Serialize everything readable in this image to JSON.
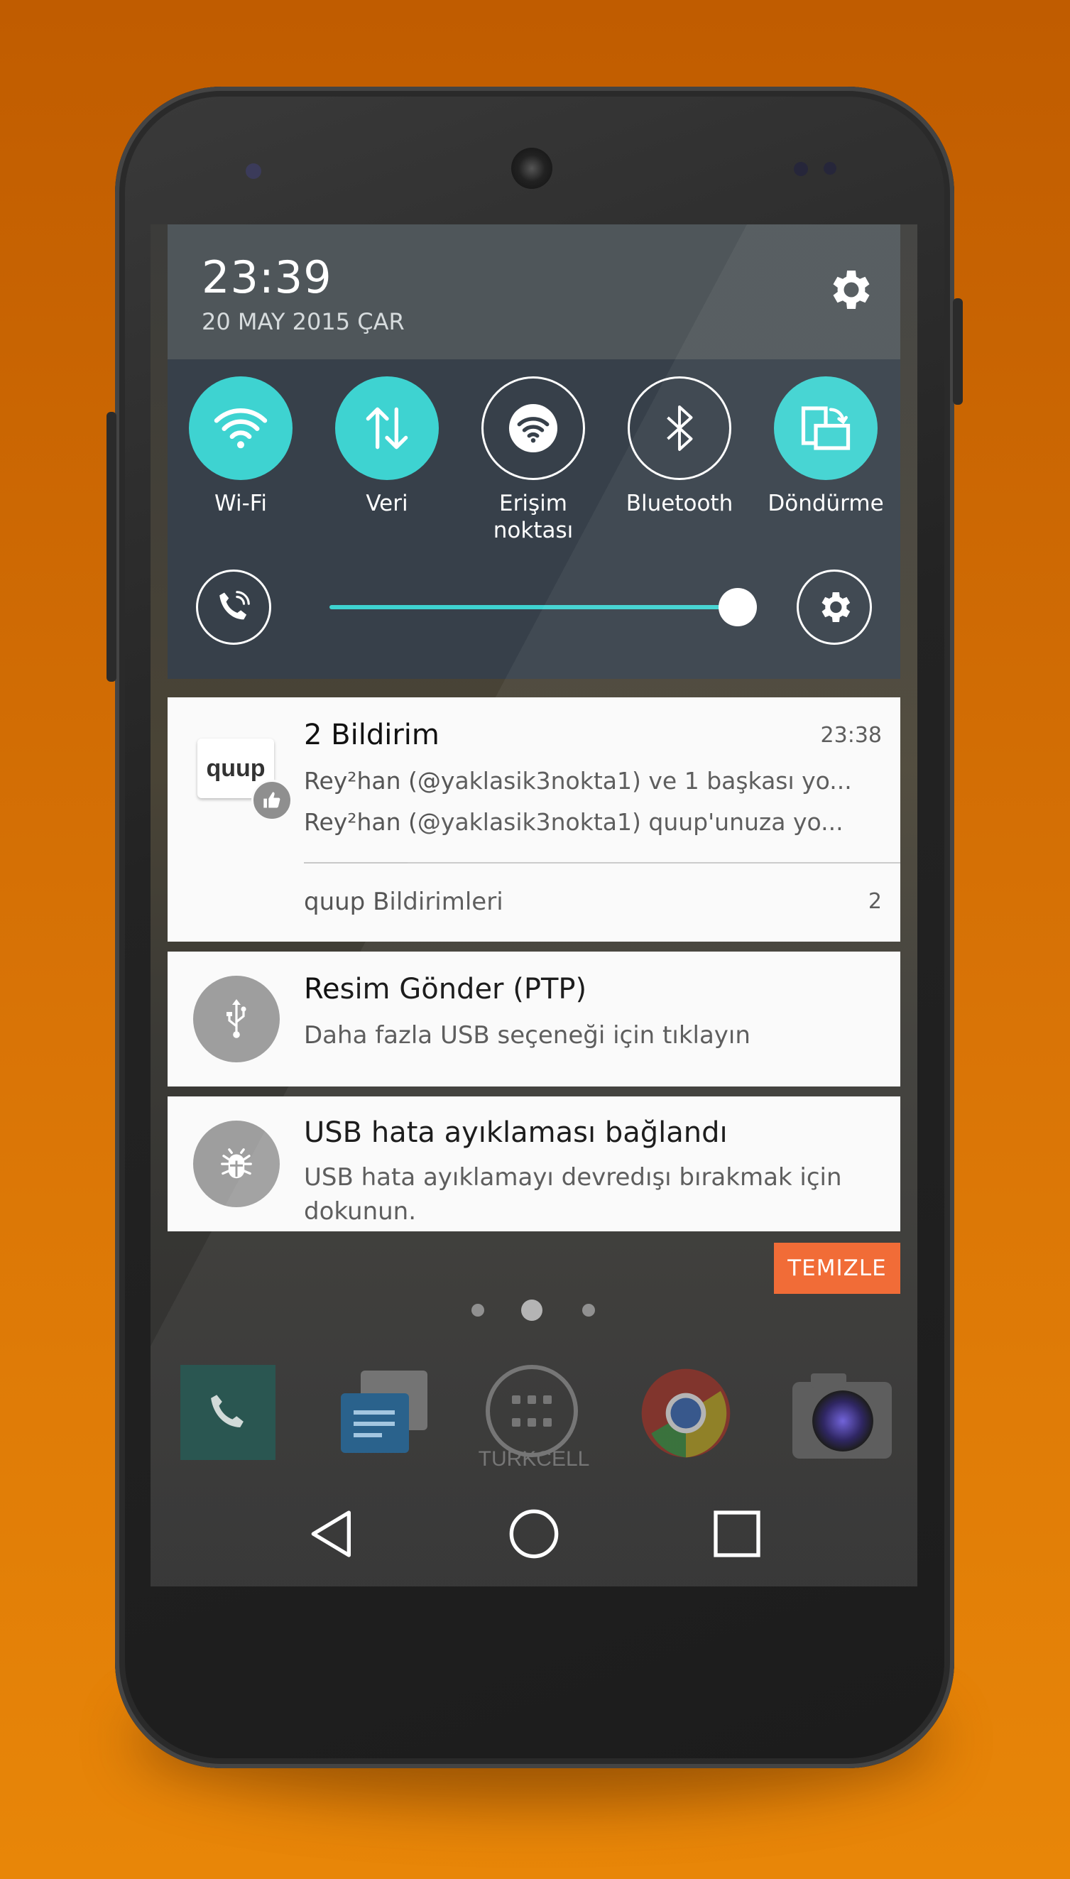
{
  "status": {
    "time": "23:39",
    "date": "20 MAY 2015 ÇAR"
  },
  "quick_settings": {
    "tiles": [
      {
        "label": "Wi-Fi",
        "active": true,
        "icon": "wifi-icon"
      },
      {
        "label": "Veri",
        "active": true,
        "icon": "data-arrows-icon"
      },
      {
        "label": "Erişim noktası",
        "active": false,
        "icon": "hotspot-icon"
      },
      {
        "label": "Bluetooth",
        "active": false,
        "icon": "bluetooth-icon"
      },
      {
        "label": "Döndürme",
        "active": true,
        "icon": "rotation-icon"
      }
    ],
    "brightness_fraction": 0.95,
    "accent_color": "#3ed3d1"
  },
  "notifications": {
    "quup": {
      "app_logo_text": "quup",
      "title": "2 Bildirim",
      "time": "23:38",
      "line1": "Rey²han (@yaklasik3nokta1) ve 1 başkası yo...",
      "line2": "Rey²han (@yaklasik3nokta1) quup'unuza yo...",
      "footer": "quup Bildirimleri",
      "count": "2"
    },
    "ptp": {
      "title": "Resim Gönder (PTP)",
      "text": "Daha fazla USB seçeneği için tıklayın"
    },
    "usb_debug": {
      "title": "USB hata ayıklaması bağlandı",
      "text_line1": "USB hata ayıklamayı devredışı bırakmak için",
      "text_line2": "dokunun."
    },
    "clear_label": "TEMIZLE"
  },
  "home": {
    "launcher_label": "TURKCELL",
    "dock": [
      "phone-icon",
      "messaging-icon",
      "app-drawer-icon",
      "chrome-icon",
      "camera-icon"
    ]
  },
  "colors": {
    "background": "#d97406",
    "clear_button": "#f0642c"
  }
}
